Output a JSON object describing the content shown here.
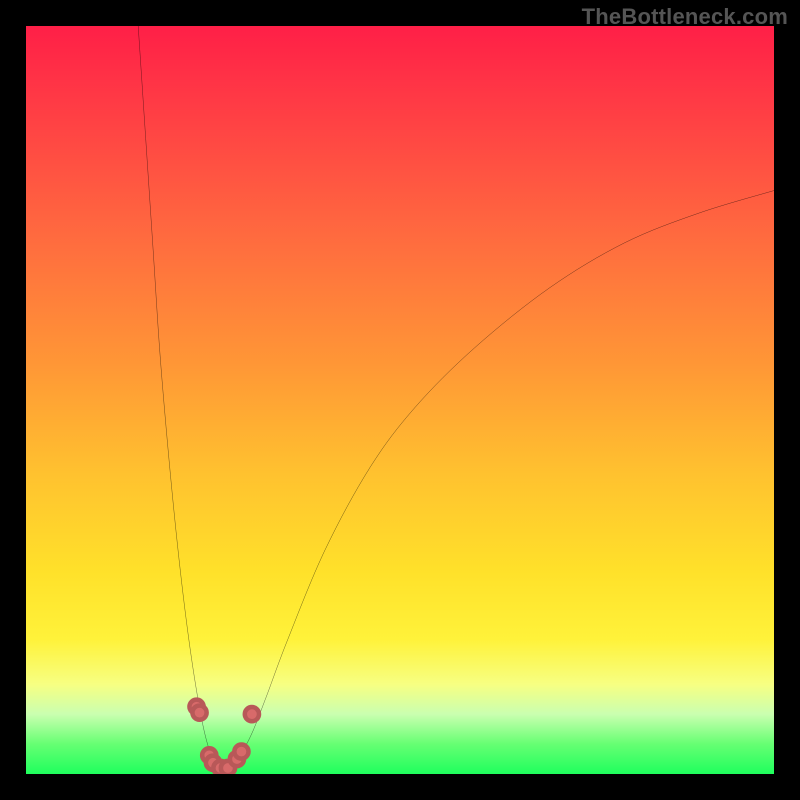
{
  "watermark": "TheBottleneck.com",
  "chart_data": {
    "type": "line",
    "title": "",
    "xlabel": "",
    "ylabel": "",
    "xlim": [
      0,
      100
    ],
    "ylim": [
      0,
      100
    ],
    "note": "V-shaped bottleneck curve over rainbow gradient. Minimum near x≈26, y≈0. Left branch exits top at x≈15; right branch rises toward x≈100, y≈78. A small cluster of dot markers sits at the trough.",
    "series": [
      {
        "name": "bottleneck-curve",
        "x": [
          15.0,
          16.0,
          17.0,
          18.0,
          19.5,
          21.0,
          22.5,
          24.0,
          25.5,
          27.0,
          28.0,
          30.0,
          32.0,
          35.0,
          40.0,
          46.0,
          52.0,
          60.0,
          70.0,
          80.0,
          90.0,
          100.0
        ],
        "y": [
          100.0,
          85.0,
          70.0,
          55.0,
          38.0,
          24.0,
          13.0,
          5.0,
          1.0,
          0.5,
          1.5,
          5.0,
          10.0,
          18.0,
          30.0,
          41.0,
          49.0,
          57.0,
          65.0,
          71.0,
          75.0,
          78.0
        ]
      }
    ],
    "markers": {
      "name": "trough-dots",
      "points": [
        {
          "x": 22.8,
          "y": 9.0
        },
        {
          "x": 23.2,
          "y": 8.2
        },
        {
          "x": 24.5,
          "y": 2.5
        },
        {
          "x": 25.0,
          "y": 1.5
        },
        {
          "x": 26.0,
          "y": 0.8
        },
        {
          "x": 27.0,
          "y": 0.8
        },
        {
          "x": 28.2,
          "y": 2.0
        },
        {
          "x": 28.8,
          "y": 3.0
        },
        {
          "x": 30.2,
          "y": 8.0
        }
      ]
    },
    "gradient_stops": [
      {
        "pos": 0,
        "color": "#ff1f47"
      },
      {
        "pos": 28,
        "color": "#ff6a3f"
      },
      {
        "pos": 60,
        "color": "#ffc22f"
      },
      {
        "pos": 82,
        "color": "#fff23a"
      },
      {
        "pos": 96,
        "color": "#66ff73"
      },
      {
        "pos": 100,
        "color": "#1fff5d"
      }
    ]
  }
}
